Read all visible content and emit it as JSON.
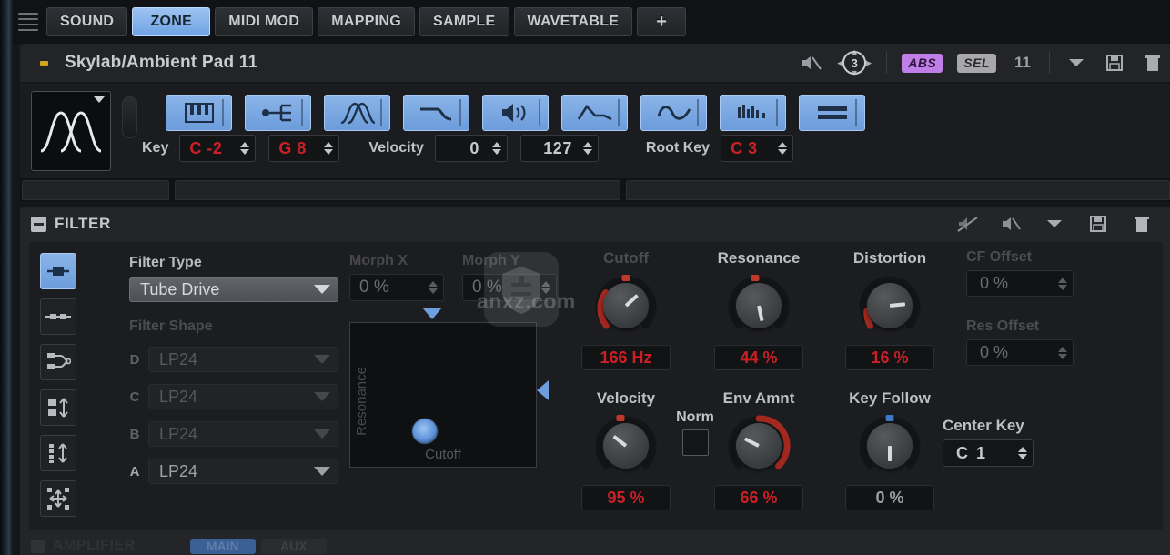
{
  "tabs": [
    {
      "label": "SOUND",
      "active": false
    },
    {
      "label": "ZONE",
      "active": true
    },
    {
      "label": "MIDI MOD",
      "active": false
    },
    {
      "label": "MAPPING",
      "active": false
    },
    {
      "label": "SAMPLE",
      "active": false
    },
    {
      "label": "WAVETABLE",
      "active": false
    },
    {
      "label": "+",
      "active": false
    }
  ],
  "preset": {
    "name": "Skylab/Ambient Pad 11",
    "polyphony": "3",
    "abs_badge": "ABS",
    "sel_badge": "SEL",
    "program_number": "11"
  },
  "zone": {
    "toggles": [
      {
        "name": "keyboard-zone-icon"
      },
      {
        "name": "trigger-icon"
      },
      {
        "name": "wavetable-icon"
      },
      {
        "name": "envelope-icon"
      },
      {
        "name": "amplifier-icon"
      },
      {
        "name": "filter-envelope-icon"
      },
      {
        "name": "lfo-icon"
      },
      {
        "name": "step-modulator-icon"
      },
      {
        "name": "list-icon"
      }
    ],
    "key_label": "Key",
    "key_low": "C -2",
    "key_high": "G 8",
    "velocity_label": "Velocity",
    "velocity_low": "0",
    "velocity_high": "127",
    "root_key_label": "Root Key",
    "root_key": "C 3"
  },
  "filter": {
    "section_title": "FILTER",
    "filter_type_label": "Filter Type",
    "filter_type_value": "Tube Drive",
    "filter_shape_label": "Filter Shape",
    "shapes": [
      {
        "letter": "D",
        "value": "LP24",
        "dim": true
      },
      {
        "letter": "C",
        "value": "LP24",
        "dim": true
      },
      {
        "letter": "B",
        "value": "LP24",
        "dim": true
      },
      {
        "letter": "A",
        "value": "LP24",
        "dim": false
      }
    ],
    "morph_x_label": "Morph X",
    "morph_x_value": "0 %",
    "morph_y_label": "Morph Y",
    "morph_y_value": "0 %",
    "xypad": {
      "y_axis_label": "Resonance",
      "x_axis_label": "Cutoff"
    },
    "knobs": [
      {
        "name": "cutoff",
        "label": "Cutoff",
        "value": "166 Hz",
        "angle": -48,
        "arc": 62,
        "led": "#c0392b",
        "red_text": true,
        "dim_label": true
      },
      {
        "name": "resonance",
        "label": "Resonance",
        "value": "44 %",
        "angle": -12,
        "arc": 0,
        "led": "#c0392b",
        "red_text": true,
        "dim_label": false
      },
      {
        "name": "distortion",
        "label": "Distortion",
        "value": "16 %",
        "angle": -76,
        "arc": 0,
        "led": "#c0392b",
        "red_text": true,
        "dim_label": false
      },
      {
        "name": "velocity",
        "label": "Velocity",
        "value": "95 %",
        "angle": -28,
        "arc": 0,
        "led": "#c0392b",
        "red_text": true,
        "dim_label": false
      },
      {
        "name": "env-amnt",
        "label": "Env Amnt",
        "value": "66 %",
        "angle": 62,
        "arc": 70,
        "led": "none",
        "red_text": true,
        "dim_label": false
      },
      {
        "name": "key-follow",
        "label": "Key Follow",
        "value": "0 %",
        "angle": 0,
        "arc": 0,
        "led": "#3f77c4",
        "red_text": false,
        "dim_label": false
      }
    ],
    "norm_label": "Norm",
    "cf_offset_label": "CF Offset",
    "cf_offset_value": "0 %",
    "res_offset_label": "Res Offset",
    "res_offset_value": "0 %",
    "center_key_label": "Center Key",
    "center_key_value": "C 1"
  },
  "amplifier": {
    "title": "AMPLIFIER",
    "tab_main": "MAIN",
    "tab_aux": "AUX"
  },
  "colors": {
    "accent_blue": "#6c9cdb",
    "value_red": "#cc2026",
    "badge_purple": "#c07fe8",
    "panel_bg": "#1c1d20"
  }
}
